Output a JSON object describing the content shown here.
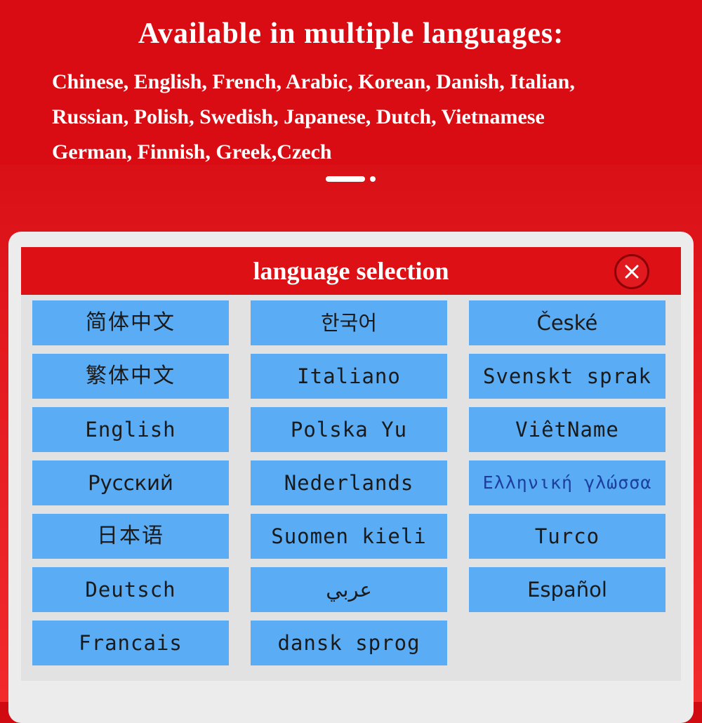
{
  "banner": {
    "headline": "Available in multiple languages:",
    "lines": [
      "Chinese, English, French, Arabic, Korean, Danish, Italian,",
      "Russian, Polish, Swedish, Japanese, Dutch, Vietnamese",
      "German, Finnish, Greek,Czech"
    ]
  },
  "dialog": {
    "title": "language selection",
    "close_icon": "close-icon",
    "accent_color": "#dd1016",
    "button_color": "#5aacf5",
    "columns": [
      [
        "简体中文",
        "繁体中文",
        "English",
        "Русский",
        "日本语",
        "Deutsch",
        "Francais"
      ],
      [
        "한국어",
        "Italiano",
        "Polska Yu",
        "Nederlands",
        "Suomen kieli",
        "عربي",
        "dansk sprog"
      ],
      [
        "České",
        "Svenskt sprak",
        "ViêtName",
        "Ελληνική γλώσσα",
        "Turco",
        "Español"
      ]
    ]
  }
}
